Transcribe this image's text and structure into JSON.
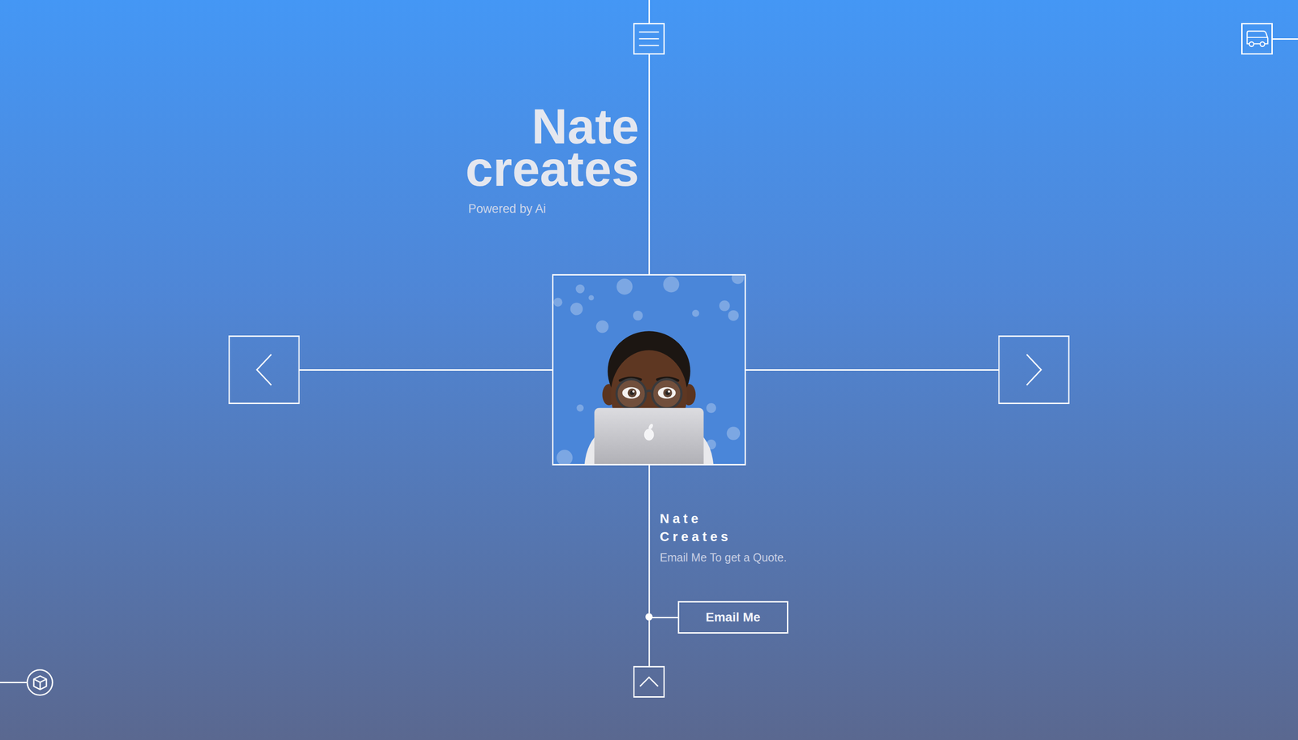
{
  "title": {
    "lines": [
      "Nate",
      "creates"
    ],
    "tagline": "Powered by Ai"
  },
  "profile": {
    "name_lines": [
      "Nate",
      "Creates"
    ],
    "description": "Email Me To get a Quote."
  },
  "cta": {
    "label": "Email Me"
  }
}
